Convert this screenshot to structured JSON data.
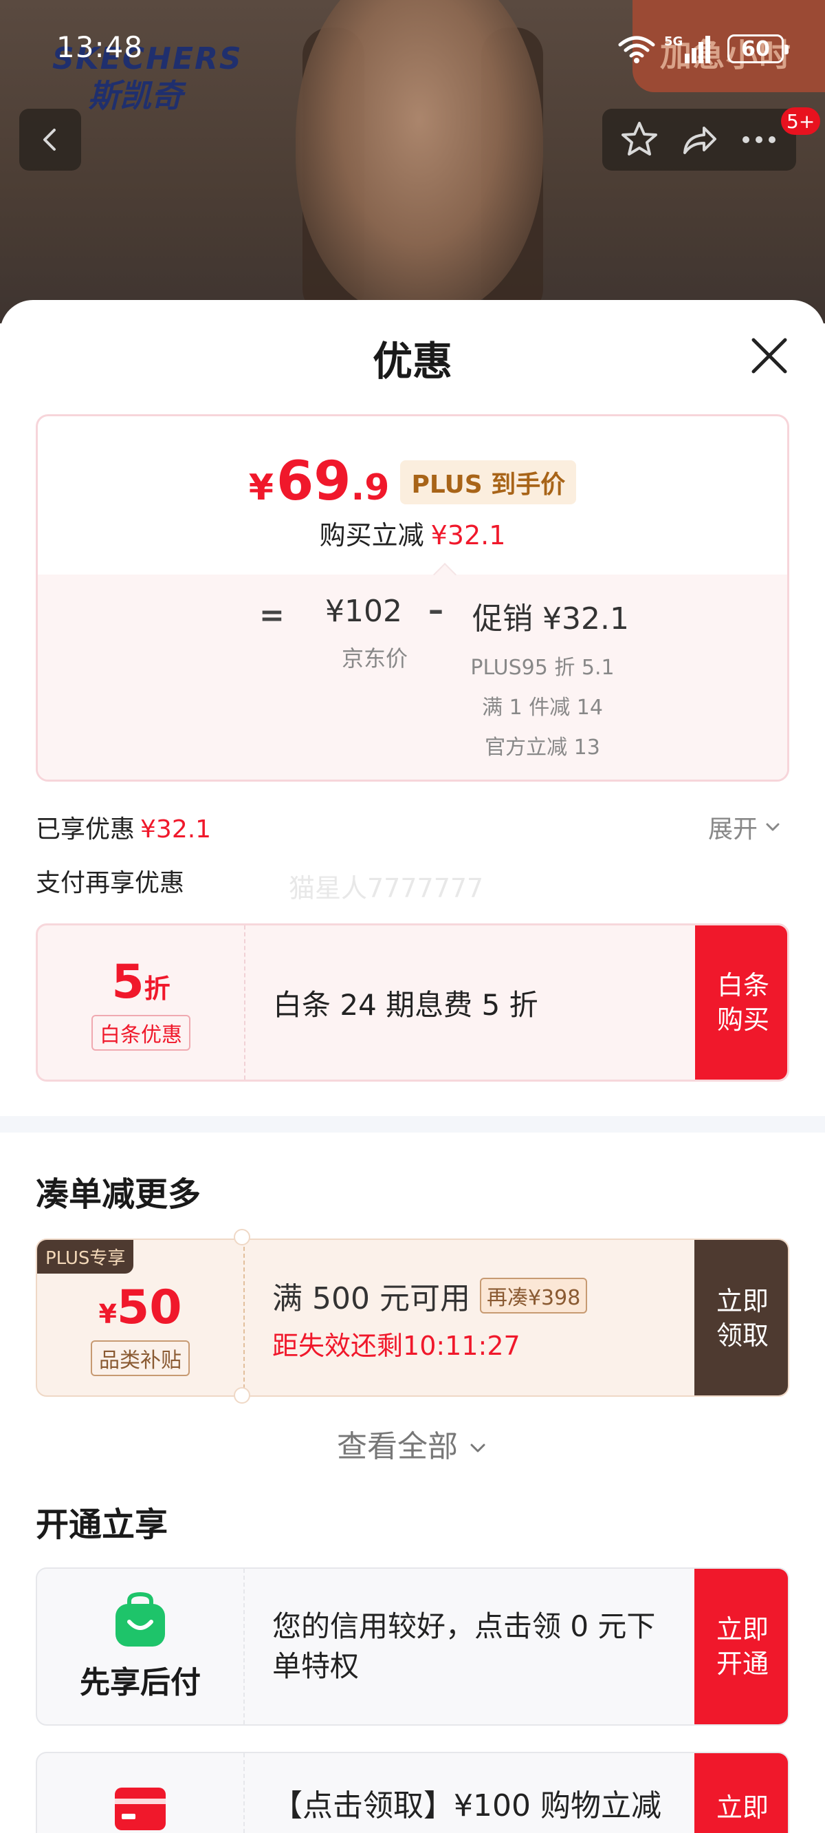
{
  "status_bar": {
    "time": "13:48",
    "network": "5G",
    "battery": "60"
  },
  "background": {
    "brand_en": "SKECHERS",
    "brand_zh": "斯凯奇",
    "corner_badge": "加急小时"
  },
  "nav": {
    "message_badge": "5+"
  },
  "sheet": {
    "title": "优惠",
    "price_card": {
      "currency": "¥",
      "price_int": "69",
      "price_dec": ".9",
      "plus_tag": "PLUS 到手价",
      "save_label": "购买立减",
      "save_amount": "¥32.1",
      "equals": "=",
      "base_price": "¥102",
      "base_label": "京东价",
      "minus": "–",
      "promo_amount": "促销 ¥32.1",
      "promo_details": [
        "PLUS95 折 5.1",
        "满 1 件减 14",
        "官方立减 13"
      ]
    },
    "enjoyed_label": "已享优惠",
    "enjoyed_amount": "¥32.1",
    "expand_label": "展开",
    "pay_more_label": "支付再享优惠",
    "watermark": "猫星人7777777",
    "baitiao": {
      "discount_num": "5",
      "discount_unit": "折",
      "tag": "白条优惠",
      "text": "白条 24 期息费 5 折",
      "button": "白条购买"
    },
    "section_more": "凑单减更多",
    "plus_coupon": {
      "badge": "PLUS专享",
      "currency": "¥",
      "amount": "50",
      "tag": "品类补贴",
      "condition": "满 500 元可用",
      "pill": "再凑¥398",
      "expiry_label": "距失效还剩",
      "expiry_time": "10:11:27",
      "button": "立即领取"
    },
    "view_all": "查看全部",
    "section_open": "开通立享",
    "xianxiang": {
      "label": "先享后付",
      "text": "您的信用较好，点击领 0 元下单特权",
      "button": "立即开通"
    },
    "gouwu": {
      "text": "【点击领取】¥100 购物立减",
      "button": "立即"
    }
  },
  "colors": {
    "accent_red": "#f0182b",
    "plus_brown": "#4e3a30",
    "gold": "#a86418"
  }
}
